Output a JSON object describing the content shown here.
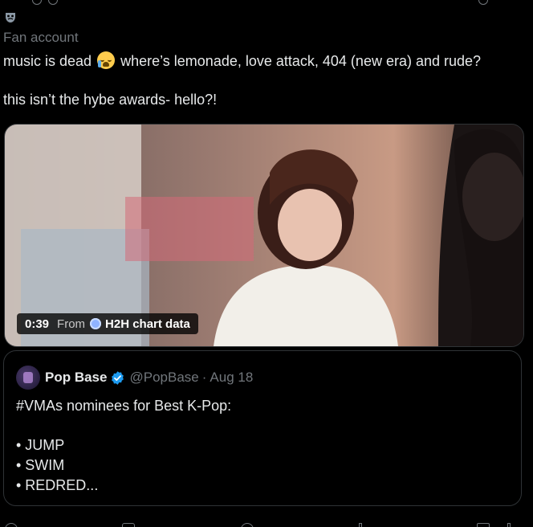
{
  "tweet": {
    "label": "Fan account",
    "text_line1_before_emoji": "music is dead",
    "emoji": "loudly-crying-face",
    "text_line1_after_emoji": "where’s lemonade, love attack, 404 (new era) and rude?",
    "text_line2": "this isn’t the hybe awards- hello?!"
  },
  "media": {
    "duration": "0:39",
    "from_label": "From",
    "source_name": "H2H chart data"
  },
  "quote": {
    "name": "Pop Base",
    "handle": "@PopBase",
    "separator": "·",
    "date": "Aug 18",
    "line1": "#VMAs nominees for Best K-Pop:",
    "bullet1": "• JUMP",
    "bullet2": "• SWIM",
    "bullet3": "• REDRED..."
  },
  "colors": {
    "background": "#000000",
    "text": "#e7e9ea",
    "muted": "#71767b",
    "border": "#2f3336",
    "verified": "#1d9bf0"
  },
  "icons": {
    "label_icon": "mask-icon",
    "verified": "verified-badge-icon",
    "actions": [
      "reply-icon",
      "repost-icon",
      "like-icon",
      "views-icon",
      "bookmark-icon",
      "share-icon"
    ]
  }
}
